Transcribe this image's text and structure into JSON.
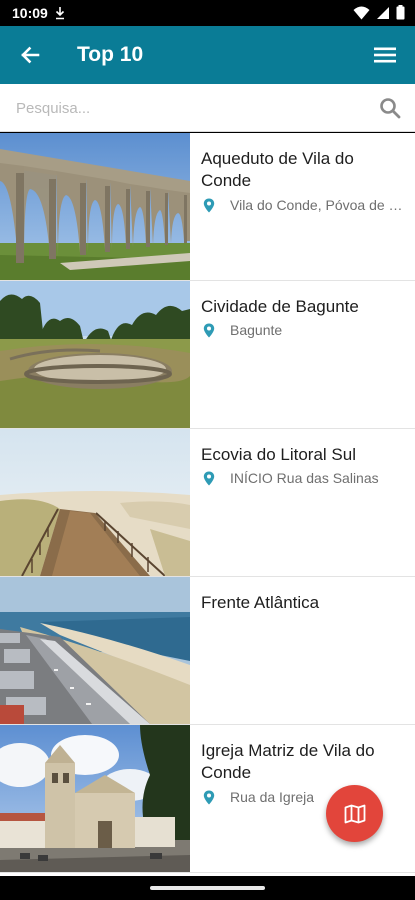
{
  "status_bar": {
    "time": "10:09"
  },
  "app_bar": {
    "title": "Top 10"
  },
  "search": {
    "placeholder": "Pesquisa..."
  },
  "list": {
    "items": [
      {
        "title": "Aqueduto de Vila do Conde",
        "location": "Vila do Conde, Póvoa de Varzim"
      },
      {
        "title": "Cividade de Bagunte",
        "location": "Bagunte"
      },
      {
        "title": "Ecovia do Litoral Sul",
        "location": "INÍCIO Rua das Salinas"
      },
      {
        "title": "Frente Atlântica",
        "location": ""
      },
      {
        "title": "Igreja Matriz de Vila do Conde",
        "location": "Rua da Igreja"
      }
    ]
  },
  "colors": {
    "app_bar": "#0a7c96",
    "fab": "#e2453b",
    "pin": "#2e9bb5"
  },
  "icons": {
    "back": "arrow-left-icon",
    "menu": "hamburger-menu-icon",
    "search": "search-icon",
    "pin": "map-pin-icon",
    "fab": "map-icon"
  }
}
